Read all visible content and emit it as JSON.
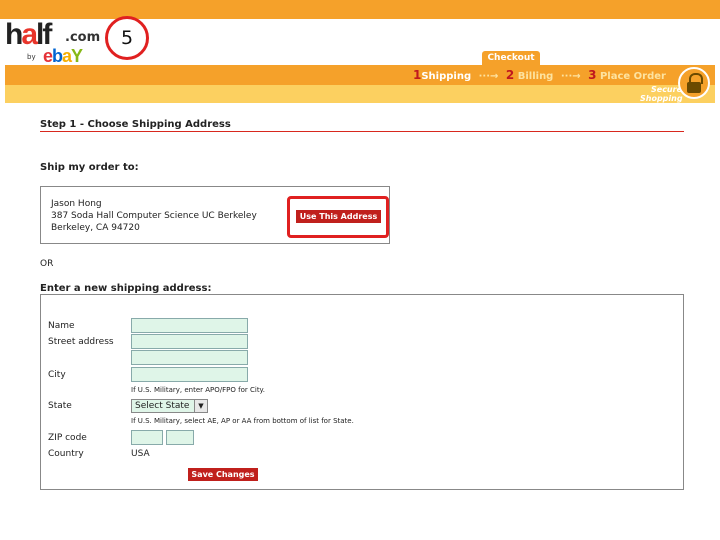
{
  "annotation": {
    "step_marker": "5"
  },
  "logo": {
    "main_prefix": "h",
    "main_a": "a",
    "main_suffix": "lf",
    "dotcom": ".com",
    "by": "by",
    "ebay": [
      "e",
      "b",
      "a",
      "Y"
    ]
  },
  "checkout": {
    "tab_label": "Checkout",
    "steps": [
      {
        "num": "1",
        "label": "Shipping"
      },
      {
        "num": "2",
        "label": "Billing"
      },
      {
        "num": "3",
        "label": "Place Order"
      }
    ],
    "secure_line1": "Secure",
    "secure_line2": "Shopping"
  },
  "step_heading": "Step 1 - Choose Shipping Address",
  "ship_to_label": "Ship my order to:",
  "saved_address": {
    "name": "Jason Hong",
    "street": "387 Soda Hall Computer Science UC Berkeley",
    "city_line": "Berkeley, CA 94720",
    "use_button": "Use This Address"
  },
  "or_label": "OR",
  "new_address": {
    "heading": "Enter a new shipping address:",
    "name_label": "Name",
    "street_label": "Street address",
    "city_label": "City",
    "city_note": "If U.S. Military, enter APO/FPO for City.",
    "state_label": "State",
    "state_selected": "Select State",
    "state_note": "If U.S. Military, select AE, AP or AA from bottom of list for State.",
    "zip_label": "ZIP code",
    "country_label": "Country",
    "country_value": "USA",
    "save_button": "Save Changes"
  },
  "colors": {
    "orange": "#f5a12a",
    "yellow": "#fcd060",
    "red": "#c0201c",
    "input_bg": "#dff5e8",
    "highlight": "#e02020"
  }
}
